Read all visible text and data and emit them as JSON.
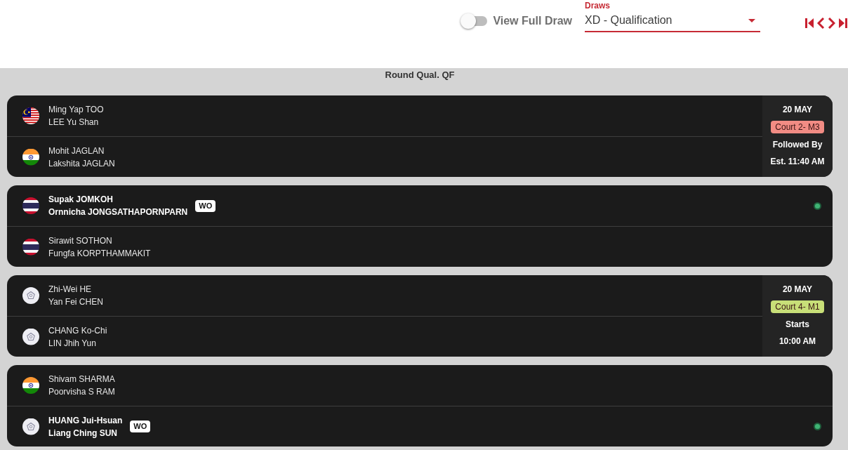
{
  "toolbar": {
    "view_full_draw": {
      "label": "View Full Draw",
      "on": false
    },
    "draws_select": {
      "label": "Draws",
      "value": "XD - Qualification"
    }
  },
  "round": {
    "title": "Round Qual. QF"
  },
  "matches": [
    {
      "teams": [
        {
          "kind": "malaysia",
          "players": [
            "Ming Yap TOO",
            "LEE Yu Shan"
          ],
          "winner": false
        },
        {
          "kind": "india",
          "players": [
            "Mohit JAGLAN",
            "Lakshita JAGLAN"
          ],
          "winner": false
        }
      ],
      "schedule": {
        "date": "20 MAY",
        "court": "Court 2- M3",
        "color": "#f28c84",
        "label": "Followed By",
        "time": "Est. 11:40 AM"
      }
    },
    {
      "teams": [
        {
          "kind": "thailand",
          "players": [
            "Supak JOMKOH",
            "Ornnicha JONGSATHAPORNPARN"
          ],
          "winner": true,
          "badge": "WO"
        },
        {
          "kind": "thailand",
          "players": [
            "Sirawit SOTHON",
            "Fungfa KORPTHAMMAKIT"
          ],
          "winner": false
        }
      ]
    },
    {
      "teams": [
        {
          "kind": "chinese-taipei",
          "players": [
            "Zhi-Wei HE",
            "Yan Fei CHEN"
          ],
          "winner": false
        },
        {
          "kind": "chinese-taipei",
          "players": [
            "CHANG Ko-Chi",
            "LIN Jhih Yun"
          ],
          "winner": false
        }
      ],
      "schedule": {
        "date": "20 MAY",
        "court": "Court 4- M1",
        "color": "#c8df78",
        "label": "Starts",
        "time": "10:00 AM"
      }
    },
    {
      "teams": [
        {
          "kind": "india",
          "players": [
            "Shivam SHARMA",
            "Poorvisha S RAM"
          ],
          "winner": false
        },
        {
          "kind": "chinese-taipei",
          "players": [
            "HUANG Jui-Hsuan",
            "Liang Ching SUN"
          ],
          "winner": true,
          "badge": "WO"
        }
      ]
    }
  ]
}
